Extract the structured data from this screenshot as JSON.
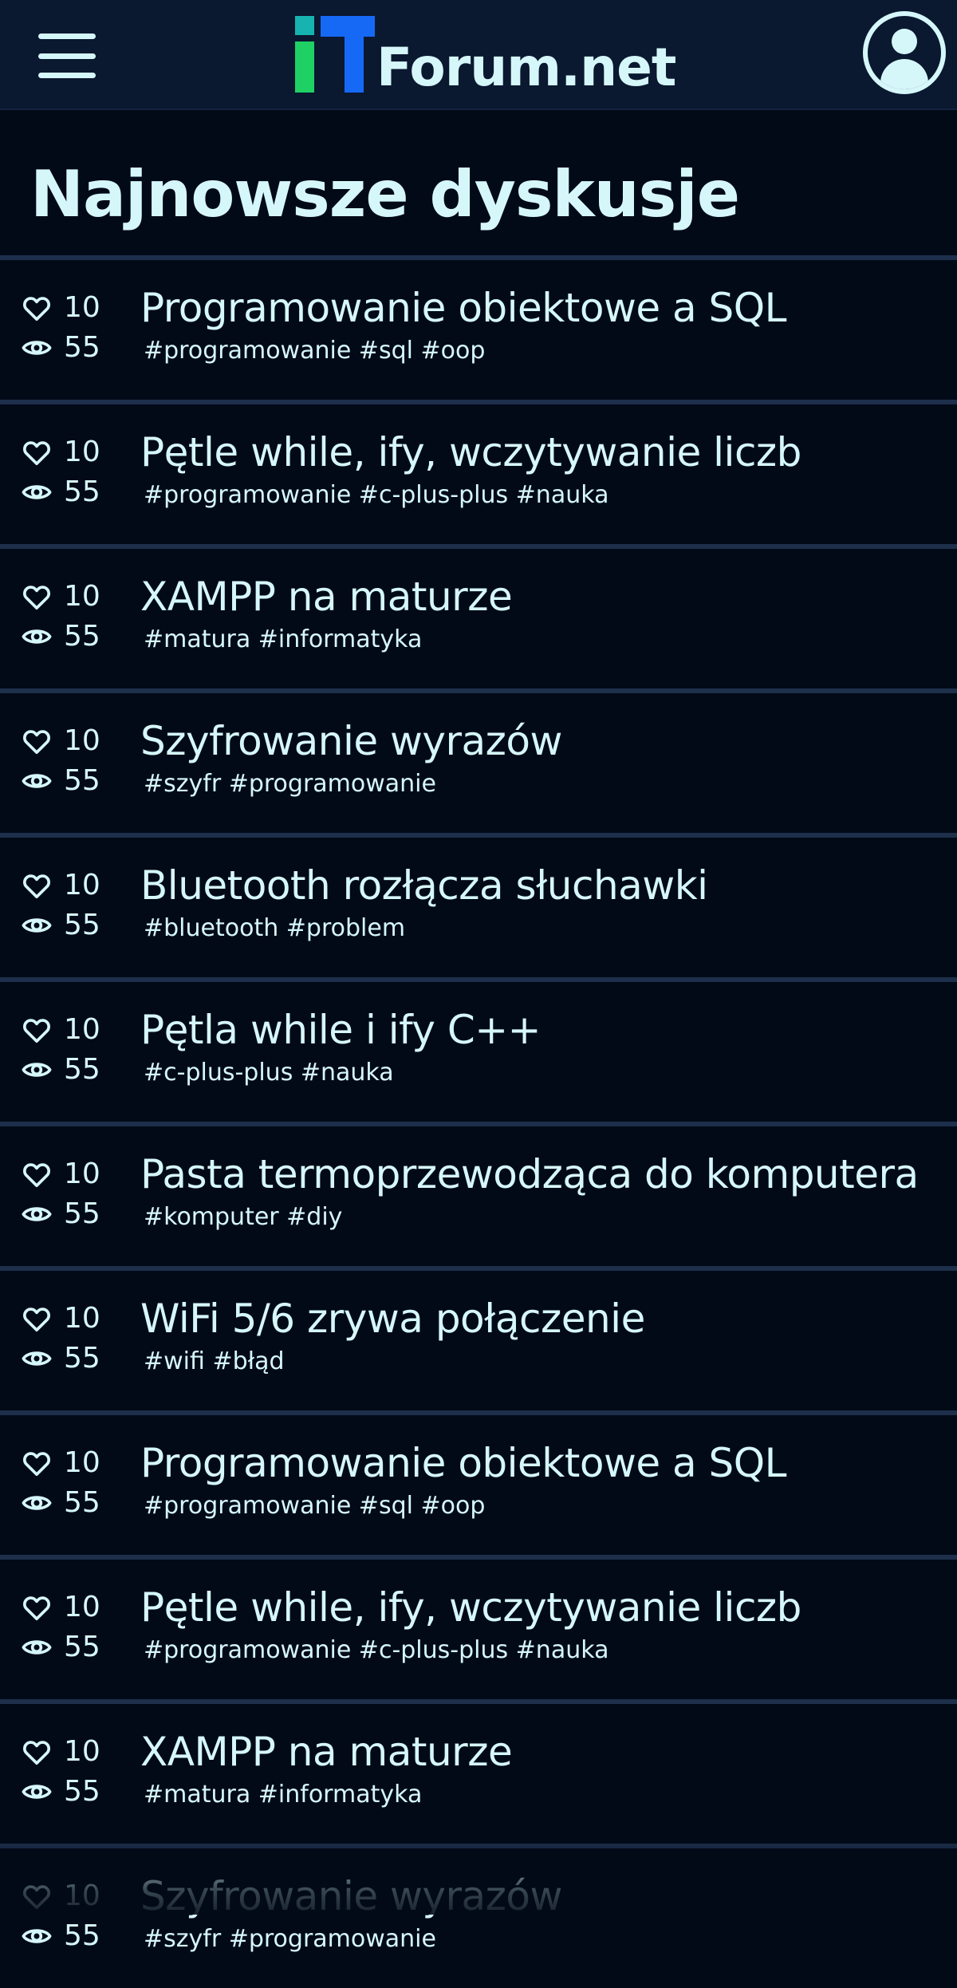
{
  "header": {
    "logo_text": "Forum.net",
    "colors": {
      "background": "#0a1830",
      "logo_dot": "#17b3b0",
      "logo_stem": "#1fd164",
      "logo_t": "#1669f5",
      "text": "#d6f7fa"
    },
    "icons": {
      "menu": "hamburger-menu-icon",
      "profile": "user-avatar-icon"
    }
  },
  "page": {
    "title": "Najnowsze dyskusje"
  },
  "thread_icons": {
    "likes": "heart-icon",
    "views": "eye-icon"
  },
  "threads": [
    {
      "likes": "10",
      "views": "55",
      "title": "Programowanie obiektowe a SQL",
      "tags": "#programowanie #sql #oop"
    },
    {
      "likes": "10",
      "views": "55",
      "title": "Pętle while, ify, wczytywanie liczb",
      "tags": "#programowanie #c-plus-plus #nauka"
    },
    {
      "likes": "10",
      "views": "55",
      "title": "XAMPP na maturze",
      "tags": "#matura #informatyka"
    },
    {
      "likes": "10",
      "views": "55",
      "title": "Szyfrowanie wyrazów",
      "tags": "#szyfr #programowanie"
    },
    {
      "likes": "10",
      "views": "55",
      "title": "Bluetooth rozłącza słuchawki",
      "tags": "#bluetooth #problem"
    },
    {
      "likes": "10",
      "views": "55",
      "title": "Pętla while i ify C++",
      "tags": "#c-plus-plus #nauka"
    },
    {
      "likes": "10",
      "views": "55",
      "title": "Pasta termoprzewodząca do komputera",
      "tags": "#komputer #diy"
    },
    {
      "likes": "10",
      "views": "55",
      "title": "WiFi 5/6 zrywa połączenie",
      "tags": "#wifi #błąd"
    },
    {
      "likes": "10",
      "views": "55",
      "title": "Programowanie obiektowe a SQL",
      "tags": "#programowanie #sql #oop"
    },
    {
      "likes": "10",
      "views": "55",
      "title": "Pętle while, ify, wczytywanie liczb",
      "tags": "#programowanie #c-plus-plus #nauka"
    },
    {
      "likes": "10",
      "views": "55",
      "title": "XAMPP na maturze",
      "tags": "#matura #informatyka"
    },
    {
      "likes": "10",
      "views": "55",
      "title": "Szyfrowanie wyrazów",
      "tags": "#szyfr #programowanie"
    }
  ]
}
